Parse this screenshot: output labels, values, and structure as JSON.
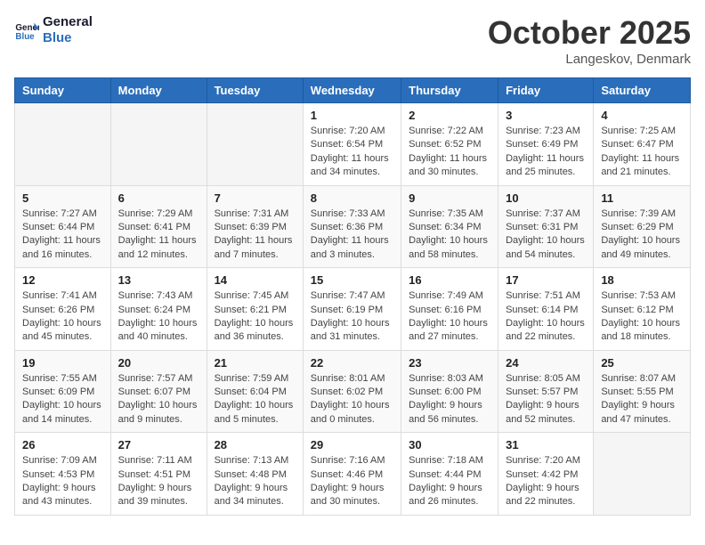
{
  "header": {
    "logo_line1": "General",
    "logo_line2": "Blue",
    "month": "October 2025",
    "location": "Langeskov, Denmark"
  },
  "days_of_week": [
    "Sunday",
    "Monday",
    "Tuesday",
    "Wednesday",
    "Thursday",
    "Friday",
    "Saturday"
  ],
  "weeks": [
    [
      {
        "day": "",
        "info": ""
      },
      {
        "day": "",
        "info": ""
      },
      {
        "day": "",
        "info": ""
      },
      {
        "day": "1",
        "info": "Sunrise: 7:20 AM\nSunset: 6:54 PM\nDaylight: 11 hours\nand 34 minutes."
      },
      {
        "day": "2",
        "info": "Sunrise: 7:22 AM\nSunset: 6:52 PM\nDaylight: 11 hours\nand 30 minutes."
      },
      {
        "day": "3",
        "info": "Sunrise: 7:23 AM\nSunset: 6:49 PM\nDaylight: 11 hours\nand 25 minutes."
      },
      {
        "day": "4",
        "info": "Sunrise: 7:25 AM\nSunset: 6:47 PM\nDaylight: 11 hours\nand 21 minutes."
      }
    ],
    [
      {
        "day": "5",
        "info": "Sunrise: 7:27 AM\nSunset: 6:44 PM\nDaylight: 11 hours\nand 16 minutes."
      },
      {
        "day": "6",
        "info": "Sunrise: 7:29 AM\nSunset: 6:41 PM\nDaylight: 11 hours\nand 12 minutes."
      },
      {
        "day": "7",
        "info": "Sunrise: 7:31 AM\nSunset: 6:39 PM\nDaylight: 11 hours\nand 7 minutes."
      },
      {
        "day": "8",
        "info": "Sunrise: 7:33 AM\nSunset: 6:36 PM\nDaylight: 11 hours\nand 3 minutes."
      },
      {
        "day": "9",
        "info": "Sunrise: 7:35 AM\nSunset: 6:34 PM\nDaylight: 10 hours\nand 58 minutes."
      },
      {
        "day": "10",
        "info": "Sunrise: 7:37 AM\nSunset: 6:31 PM\nDaylight: 10 hours\nand 54 minutes."
      },
      {
        "day": "11",
        "info": "Sunrise: 7:39 AM\nSunset: 6:29 PM\nDaylight: 10 hours\nand 49 minutes."
      }
    ],
    [
      {
        "day": "12",
        "info": "Sunrise: 7:41 AM\nSunset: 6:26 PM\nDaylight: 10 hours\nand 45 minutes."
      },
      {
        "day": "13",
        "info": "Sunrise: 7:43 AM\nSunset: 6:24 PM\nDaylight: 10 hours\nand 40 minutes."
      },
      {
        "day": "14",
        "info": "Sunrise: 7:45 AM\nSunset: 6:21 PM\nDaylight: 10 hours\nand 36 minutes."
      },
      {
        "day": "15",
        "info": "Sunrise: 7:47 AM\nSunset: 6:19 PM\nDaylight: 10 hours\nand 31 minutes."
      },
      {
        "day": "16",
        "info": "Sunrise: 7:49 AM\nSunset: 6:16 PM\nDaylight: 10 hours\nand 27 minutes."
      },
      {
        "day": "17",
        "info": "Sunrise: 7:51 AM\nSunset: 6:14 PM\nDaylight: 10 hours\nand 22 minutes."
      },
      {
        "day": "18",
        "info": "Sunrise: 7:53 AM\nSunset: 6:12 PM\nDaylight: 10 hours\nand 18 minutes."
      }
    ],
    [
      {
        "day": "19",
        "info": "Sunrise: 7:55 AM\nSunset: 6:09 PM\nDaylight: 10 hours\nand 14 minutes."
      },
      {
        "day": "20",
        "info": "Sunrise: 7:57 AM\nSunset: 6:07 PM\nDaylight: 10 hours\nand 9 minutes."
      },
      {
        "day": "21",
        "info": "Sunrise: 7:59 AM\nSunset: 6:04 PM\nDaylight: 10 hours\nand 5 minutes."
      },
      {
        "day": "22",
        "info": "Sunrise: 8:01 AM\nSunset: 6:02 PM\nDaylight: 10 hours\nand 0 minutes."
      },
      {
        "day": "23",
        "info": "Sunrise: 8:03 AM\nSunset: 6:00 PM\nDaylight: 9 hours\nand 56 minutes."
      },
      {
        "day": "24",
        "info": "Sunrise: 8:05 AM\nSunset: 5:57 PM\nDaylight: 9 hours\nand 52 minutes."
      },
      {
        "day": "25",
        "info": "Sunrise: 8:07 AM\nSunset: 5:55 PM\nDaylight: 9 hours\nand 47 minutes."
      }
    ],
    [
      {
        "day": "26",
        "info": "Sunrise: 7:09 AM\nSunset: 4:53 PM\nDaylight: 9 hours\nand 43 minutes."
      },
      {
        "day": "27",
        "info": "Sunrise: 7:11 AM\nSunset: 4:51 PM\nDaylight: 9 hours\nand 39 minutes."
      },
      {
        "day": "28",
        "info": "Sunrise: 7:13 AM\nSunset: 4:48 PM\nDaylight: 9 hours\nand 34 minutes."
      },
      {
        "day": "29",
        "info": "Sunrise: 7:16 AM\nSunset: 4:46 PM\nDaylight: 9 hours\nand 30 minutes."
      },
      {
        "day": "30",
        "info": "Sunrise: 7:18 AM\nSunset: 4:44 PM\nDaylight: 9 hours\nand 26 minutes."
      },
      {
        "day": "31",
        "info": "Sunrise: 7:20 AM\nSunset: 4:42 PM\nDaylight: 9 hours\nand 22 minutes."
      },
      {
        "day": "",
        "info": ""
      }
    ]
  ]
}
